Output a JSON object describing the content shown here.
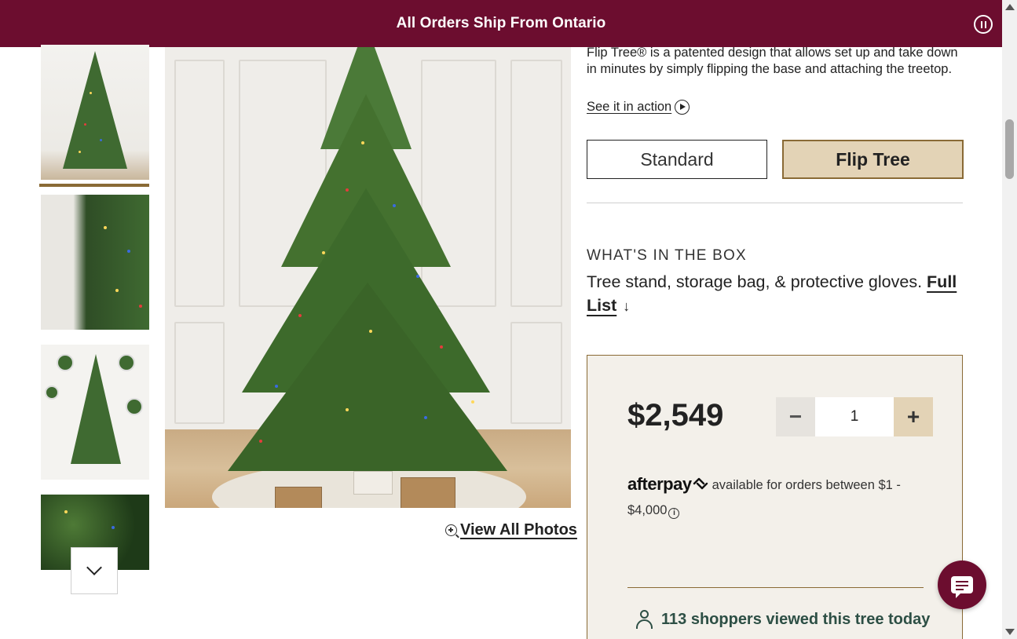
{
  "announcement": {
    "text": "All Orders Ship From Ontario"
  },
  "gallery": {
    "view_all_label": "View All Photos"
  },
  "product": {
    "description": "Flip Tree® is a patented design that allows set up and take down in minutes by simply flipping the base and attaching the treetop.",
    "see_action_label": "See it in action",
    "options": [
      {
        "label": "Standard",
        "selected": false
      },
      {
        "label": "Flip Tree",
        "selected": true
      }
    ],
    "box": {
      "heading": "WHAT'S IN THE BOX",
      "text": "Tree stand, storage bag, & protective gloves.",
      "full_list_label": "Full List",
      "arrow_glyph": "↓"
    }
  },
  "purchase": {
    "price": "$2,549",
    "quantity": "1",
    "minus_label": "−",
    "plus_label": "+",
    "afterpay_logo": "afterpay",
    "afterpay_text": "available for orders between $1 - $4,000",
    "info_glyph": "i",
    "viewers_text": "113 shoppers viewed this tree today"
  },
  "colors": {
    "brand": "#6c0d2f",
    "accent_gold": "#8a6a35",
    "selected_fill": "#e3d3b6",
    "price_box_bg": "#f3f0ea",
    "viewers_green": "#2d4f45"
  }
}
